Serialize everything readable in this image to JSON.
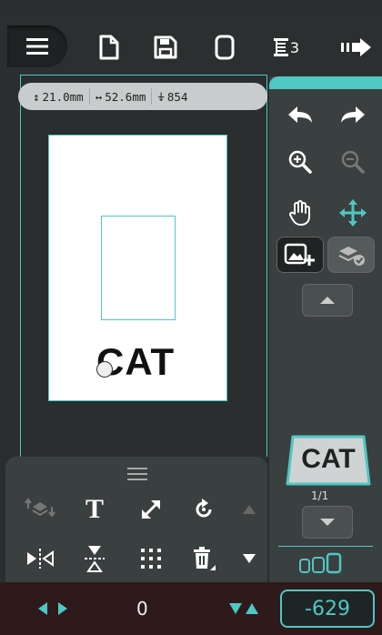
{
  "toolbar": {
    "menu_icon": "hamburger-menu-icon",
    "new_icon": "new-file-icon",
    "save_icon": "save-icon",
    "frame_icon": "label-shape-icon",
    "layers_icon": "layers-icon",
    "layers_count": "3",
    "print_icon": "send-print-icon"
  },
  "measure": {
    "height": "21.0mm",
    "width": "52.6mm",
    "dots": "854"
  },
  "label": {
    "text": "CAT"
  },
  "right_panel": {
    "undo_icon": "undo-icon",
    "redo_icon": "redo-icon",
    "zoom_in_icon": "zoom-in-icon",
    "zoom_out_icon": "zoom-out-icon",
    "pan_icon": "hand-pan-icon",
    "move_icon": "move-arrows-icon",
    "add_image_icon": "add-image-icon",
    "layer_check_icon": "layer-check-icon",
    "thumbnail_text": "CAT",
    "page_indicator": "1/1"
  },
  "tools": {
    "row1": [
      "layer-order-icon",
      "text-icon",
      "resize-icon",
      "rotate-icon",
      "scroll-up-icon"
    ],
    "row2": [
      "mirror-horizontal-icon",
      "mirror-vertical-icon",
      "grid-dots-icon",
      "delete-icon",
      "scroll-down-icon"
    ],
    "text_label": "T"
  },
  "statusbar": {
    "horizontal_value": "0",
    "vertical_value": "-629"
  },
  "colors": {
    "accent": "#4fc7c4",
    "panel": "#3a3f3f",
    "background": "#2a2e2e",
    "status_bg": "#2e1a1b"
  }
}
